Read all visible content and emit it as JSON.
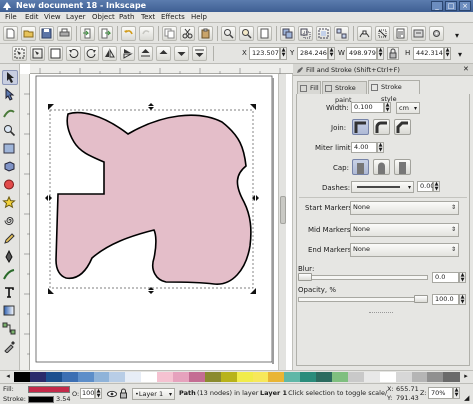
{
  "window": {
    "title": "New document 18 - Inkscape",
    "buttons": [
      "_",
      "□",
      "×"
    ]
  },
  "menu": [
    "File",
    "Edit",
    "View",
    "Layer",
    "Object",
    "Path",
    "Text",
    "Effects",
    "Help"
  ],
  "ctrl": {
    "x_label": "X",
    "x_value": "123.507",
    "y_label": "Y",
    "y_value": "284.246",
    "w_label": "W",
    "w_value": "498.979",
    "h_label": "H",
    "h_value": "442.314"
  },
  "panel": {
    "title": "Fill and Stroke (Shift+Ctrl+F)",
    "tabs": [
      "Fill",
      "Stroke paint",
      "Stroke style"
    ],
    "width_label": "Width:",
    "width_value": "0.100",
    "width_unit": "cm",
    "join_label": "Join:",
    "miter_label": "Miter limit:",
    "miter_value": "4.00",
    "cap_label": "Cap:",
    "dashes_label": "Dashes:",
    "dashes_value": "0.00",
    "start_label": "Start Markers:",
    "start_value": "None",
    "mid_label": "Mid Markers:",
    "mid_value": "None",
    "end_label": "End Markers:",
    "end_value": "None",
    "blur_label": "Blur:",
    "blur_value": "0.0",
    "blur_fraction": 0.0,
    "opacity_label": "Opacity, %",
    "opacity_value": "100.0",
    "opacity_fraction": 1.0
  },
  "palette": {
    "colors": [
      "#000000",
      "#2b2b6b",
      "#1c4f8f",
      "#3c6fb3",
      "#5d8ec9",
      "#8fb3d9",
      "#b8cde6",
      "#e7edf6",
      "#ffffff",
      "#f5c2d1",
      "#e6a2bd",
      "#c46d93",
      "#8b8b2f",
      "#b8b31a",
      "#f1ec4a",
      "#f7e85a",
      "#e9b534",
      "#5fb7a7",
      "#2a8c7b",
      "#2c6b5f",
      "#7fbf7f",
      "#c9c9c9",
      "#e8e8e8",
      "#ffffff",
      "#d7d7d7",
      "#b5b5b5",
      "#909090",
      "#6a6a6a"
    ]
  },
  "status": {
    "fill_label": "Fill:",
    "stroke_label": "Stroke:",
    "stroke_width": "3.54",
    "fill_color": "#c42a4a",
    "o_label": "O:",
    "o_value": "100",
    "layer": "•Layer 1",
    "message_pre": "Path",
    "message": "(13 nodes) in layer",
    "message_layer": "Layer 1",
    "message_post": ". Click selection to toggle scale/",
    "x_label": "X:",
    "x_value": "655.71",
    "y_label": "Y:",
    "y_value": "791.43",
    "z_label": "Z:",
    "zoom": "70%"
  },
  "shape": {
    "fill": "#e4bec9",
    "stroke": "#000000"
  }
}
